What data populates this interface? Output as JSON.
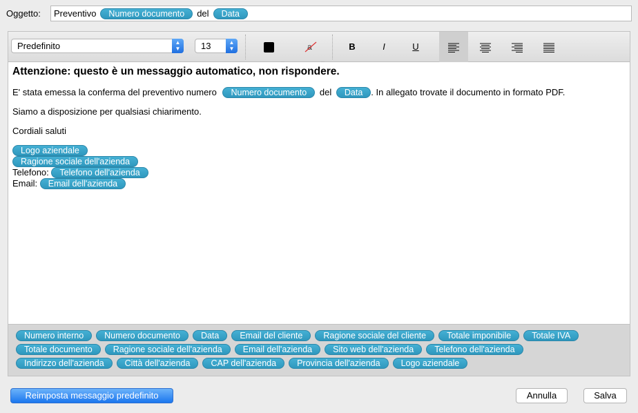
{
  "subject": {
    "label": "Oggetto:",
    "text_before": "Preventivo",
    "token_1": "Numero documento",
    "text_middle": "del",
    "token_2": "Data"
  },
  "toolbar": {
    "font_family": "Predefinito",
    "font_size": "13",
    "bold": "B",
    "italic": "I",
    "underline": "U",
    "text_color": "#000000",
    "active_alignment": "left"
  },
  "message": {
    "heading": "Attenzione: questo è un messaggio automatico, non rispondere.",
    "p1_before": "E' stata emessa la conferma del preventivo numero",
    "p1_token_1": "Numero documento",
    "p1_middle": "del",
    "p1_token_2": "Data",
    "p1_after": ". In allegato trovate il documento in formato PDF.",
    "p2": "Siamo a disposizione per qualsiasi chiarimento.",
    "p3": "Cordiali saluti",
    "sig_logo": "Logo aziendale",
    "sig_company": "Ragione sociale dell'azienda",
    "sig_phone_label": "Telefono:",
    "sig_phone_token": "Telefono dell'azienda",
    "sig_email_label": "Email:",
    "sig_email_token": "Email dell'azienda"
  },
  "placeholders": [
    "Numero interno",
    "Numero documento",
    "Data",
    "Email del cliente",
    "Ragione sociale del cliente",
    "Totale imponibile",
    "Totale IVA",
    "Totale documento",
    "Ragione sociale dell'azienda",
    "Email dell'azienda",
    "Sito web dell'azienda",
    "Telefono dell'azienda",
    "Indirizzo dell'azienda",
    "Città dell'azienda",
    "CAP dell'azienda",
    "Provincia dell'azienda",
    "Logo aziendale"
  ],
  "buttons": {
    "reset": "Reimposta messaggio predefinito",
    "cancel": "Annulla",
    "save": "Salva"
  },
  "colors": {
    "token": "#3aa5cb",
    "primary_button": "#1b76ee"
  }
}
